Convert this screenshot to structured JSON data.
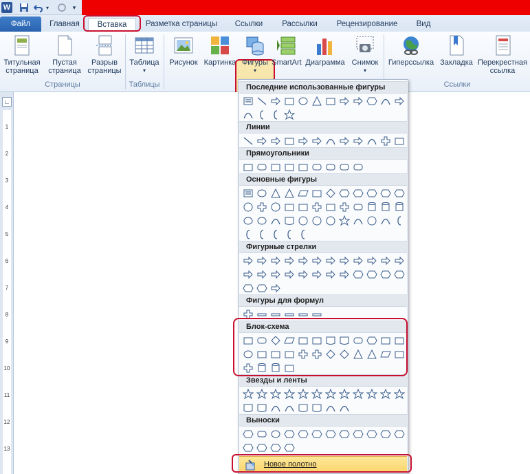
{
  "quick_access": {
    "app_icon": "word-icon",
    "save": "save-icon",
    "undo": "undo-icon",
    "redo": "redo-icon",
    "customize": "customize-icon"
  },
  "tabs": [
    {
      "label": "Файл"
    },
    {
      "label": "Главная"
    },
    {
      "label": "Вставка"
    },
    {
      "label": "Разметка страницы"
    },
    {
      "label": "Ссылки"
    },
    {
      "label": "Рассылки"
    },
    {
      "label": "Рецензирование"
    },
    {
      "label": "Вид"
    }
  ],
  "ribbon": {
    "groups": {
      "pages": "Страницы",
      "tables": "Таблицы",
      "links": "Ссылки"
    },
    "buttons": {
      "cover": [
        "Титульная",
        "страница"
      ],
      "blank": [
        "Пустая",
        "страница"
      ],
      "break": [
        "Разрыв",
        "страницы"
      ],
      "table": [
        "Таблица"
      ],
      "picture": [
        "Рисунок"
      ],
      "clipart": [
        "Картинка"
      ],
      "shapes": [
        "Фигуры"
      ],
      "smartart": [
        "SmartArt"
      ],
      "chart": [
        "Диаграмма"
      ],
      "screenshot": [
        "Снимок"
      ],
      "hyperlink": [
        "Гиперссылка"
      ],
      "bookmark": [
        "Закладка"
      ],
      "crossref": [
        "Перекрестная",
        "ссылка"
      ]
    }
  },
  "ruler": {
    "numbers": [
      "1",
      "2",
      "3",
      "4",
      "5",
      "6",
      "7",
      "8",
      "9",
      "10",
      "11",
      "12",
      "13"
    ]
  },
  "shapes_menu": {
    "sections": [
      {
        "title": "Последние использованные фигуры",
        "icons": [
          "textbox",
          "line",
          "arrow",
          "rect",
          "oval",
          "triangle",
          "elbow",
          "elbow-arrow",
          "right-arrow",
          "pentagon-callout",
          "curve",
          "curve-arrow",
          "arc",
          "brace-left",
          "brace-right",
          "star"
        ]
      },
      {
        "title": "Линии",
        "icons": [
          "line",
          "arrow",
          "double-arrow",
          "elbow",
          "elbow-arrow",
          "elbow-double-arrow",
          "curve",
          "curve-arrow",
          "curve-double-arrow",
          "arc-curve",
          "freeform",
          "scribble"
        ]
      },
      {
        "title": "Прямоугольники",
        "icons": [
          "rect",
          "round-rect",
          "snip-rect",
          "snip2-rect",
          "snip-diag",
          "round-snip",
          "round-one",
          "round-same",
          "round-diag"
        ]
      },
      {
        "title": "Основные фигуры",
        "icons": [
          "textbox",
          "oval",
          "triangle",
          "right-triangle",
          "parallelogram",
          "trapezoid",
          "diamond",
          "hexagon",
          "heptagon",
          "octagon",
          "decagon",
          "dodecagon",
          "pie",
          "chord",
          "teardrop",
          "frame",
          "half-frame",
          "corner",
          "diag-stripe",
          "cross",
          "plaque",
          "can",
          "cube",
          "bevel",
          "donut",
          "no-symbol",
          "block-arc",
          "folded",
          "smiley",
          "heart",
          "lightning",
          "sun",
          "moon",
          "cloud",
          "arc",
          "bracket-pair",
          "brace-pair",
          "bracket-l",
          "bracket-r",
          "brace-l",
          "brace-r"
        ]
      },
      {
        "title": "Фигурные стрелки",
        "icons": [
          "arrow-right",
          "arrow-left",
          "arrow-up",
          "arrow-down",
          "arrow-lr",
          "arrow-ud",
          "arrow-quad",
          "arrow-lru",
          "arrow-bent",
          "arrow-uturn",
          "arrow-lu",
          "arrow-bentup",
          "arrow-curve-r",
          "arrow-curve-l",
          "arrow-curve-u",
          "arrow-curve-d",
          "arrow-striped",
          "arrow-notched",
          "arrow-pentagon",
          "arrow-chevron",
          "callout-right",
          "callout-down",
          "callout-left",
          "callout-up",
          "callout-lr",
          "callout-quad",
          "arrow-circular"
        ]
      },
      {
        "title": "Фигуры для формул",
        "icons": [
          "plus",
          "minus",
          "multiply",
          "divide",
          "equal",
          "not-equal"
        ]
      },
      {
        "title": "Блок-схема",
        "icons": [
          "process",
          "alt-process",
          "decision",
          "data",
          "predefined",
          "internal",
          "document",
          "multidoc",
          "terminator",
          "preparation",
          "manual-input",
          "manual-op",
          "connector",
          "offpage",
          "card",
          "punched-tape",
          "summing",
          "or",
          "collate",
          "sort",
          "extract",
          "merge",
          "stored-data",
          "delay",
          "seq-storage",
          "magnetic-disk",
          "direct-storage",
          "display"
        ]
      },
      {
        "title": "Звезды и ленты",
        "icons": [
          "explosion1",
          "explosion2",
          "star4",
          "star5",
          "star6",
          "star7",
          "star8",
          "star10",
          "star12",
          "star16",
          "star24",
          "star32",
          "ribbon-down",
          "ribbon-up",
          "ribbon-curved-down",
          "ribbon-curved-up",
          "scroll-v",
          "scroll-h",
          "wave",
          "double-wave"
        ]
      },
      {
        "title": "Выноски",
        "icons": [
          "callout-rect",
          "callout-round",
          "callout-oval",
          "callout-cloud",
          "callout-line1",
          "callout-line2",
          "callout-line3",
          "callout-line4",
          "callout-accent1",
          "callout-accent2",
          "callout-accent3",
          "callout-accent4",
          "callout-border1",
          "callout-border2",
          "callout-border3",
          "callout-border4"
        ]
      }
    ],
    "new_canvas": "Новое полотно"
  }
}
